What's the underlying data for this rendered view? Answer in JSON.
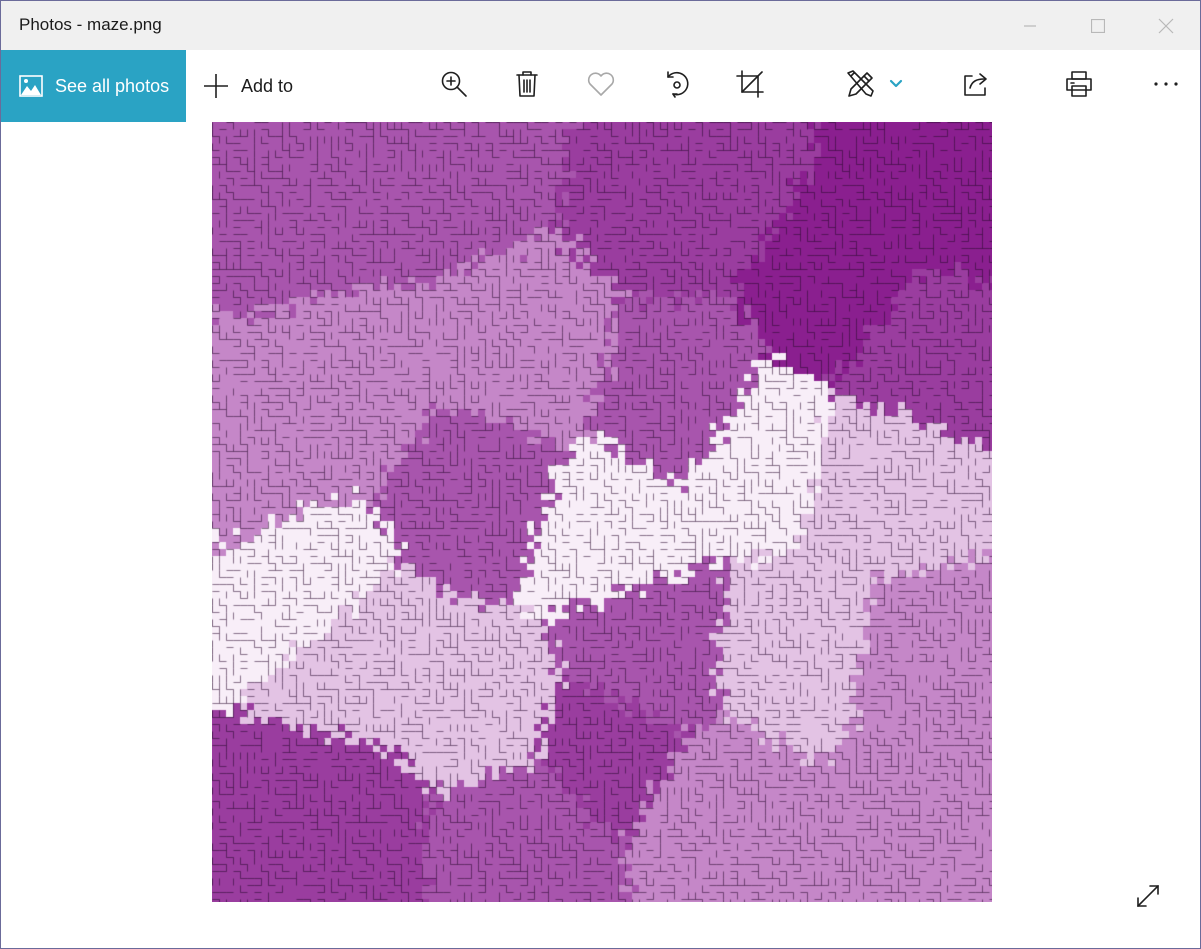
{
  "window": {
    "title": "Photos - maze.png"
  },
  "toolbar": {
    "see_all_label": "See all photos",
    "add_to_label": "Add to",
    "icons": [
      "zoom-in-icon",
      "delete-icon",
      "favorite-icon",
      "rotate-icon",
      "crop-icon",
      "edit-draw-icon",
      "chevron-down-icon",
      "share-icon",
      "print-icon",
      "more-icon"
    ],
    "accent_color": "#2aa3c4",
    "favorite_disabled": true
  },
  "image": {
    "filename": "maze.png",
    "palette": [
      "#a855ad",
      "#c587c8",
      "#8a1f8f",
      "#e3c3e4",
      "#f8eef8",
      "#9a3d9f"
    ]
  }
}
